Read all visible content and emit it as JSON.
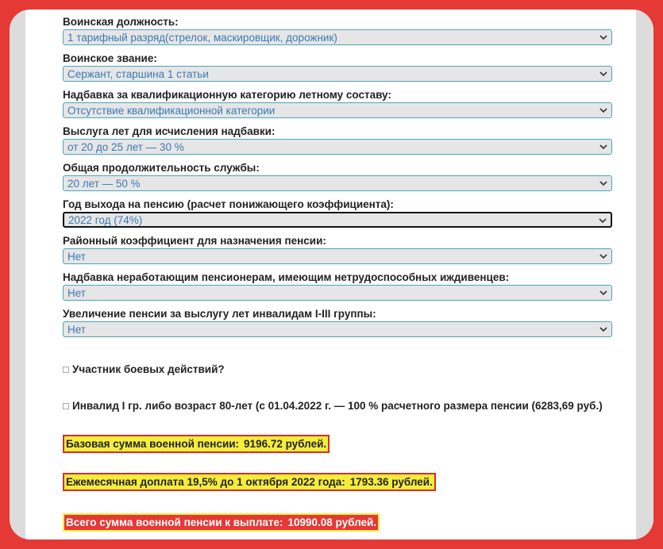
{
  "fields": [
    {
      "label": "Воинская должность:",
      "value": "1 тарифный разряд(стрелок, маскировщик, дорожник)"
    },
    {
      "label": "Воинское звание:",
      "value": "Сержант, старшина 1 статьи"
    },
    {
      "label": "Надбавка за квалификационную категорию летному составу:",
      "value": "Отсутствие квалификационной категории"
    },
    {
      "label": "Выслуга лет для исчисления надбавки:",
      "value": "от 20 до 25 лет — 30 %"
    },
    {
      "label": "Общая продолжительность службы:",
      "value": "20 лет — 50 %"
    },
    {
      "label": "Год выхода на пенсию (расчет понижающего коэффициента):",
      "value": "2022 год (74%)"
    },
    {
      "label": "Районный коэффициент для назначения пенсии:",
      "value": "Нет"
    },
    {
      "label": "Надбавка неработающим пенсионерам, имеющим нетрудоспособных иждивенцев:",
      "value": "Нет"
    },
    {
      "label": "Увеличение пенсии за выслугу лет инвалидам I-III группы:",
      "value": "Нет"
    }
  ],
  "checkboxes": [
    {
      "label": "Участник боевых действий?"
    },
    {
      "label": "Инвалид I гр. либо возраст 80-лет (с 01.04.2022 г. — 100 % расчетного размера пенсии (6283,69 руб.)"
    }
  ],
  "results": {
    "base": {
      "label": "Базовая сумма военной пенсии:",
      "value": "9196.72 рублей."
    },
    "monthly": {
      "label": "Ежемесячная доплата 19,5% до 1 октября 2022 года:",
      "value": "1793.36 рублей."
    },
    "total": {
      "label": "Всего сумма военной пенсии к выплате:",
      "value": "10990.08 рублей."
    }
  },
  "colors": {
    "accent": "#e53935",
    "highlight": "#f5ed3a",
    "select_text": "#3a7ab5",
    "select_border": "#4aa6b8"
  },
  "icons": {
    "select_arrow": "chevron-down-icon"
  }
}
